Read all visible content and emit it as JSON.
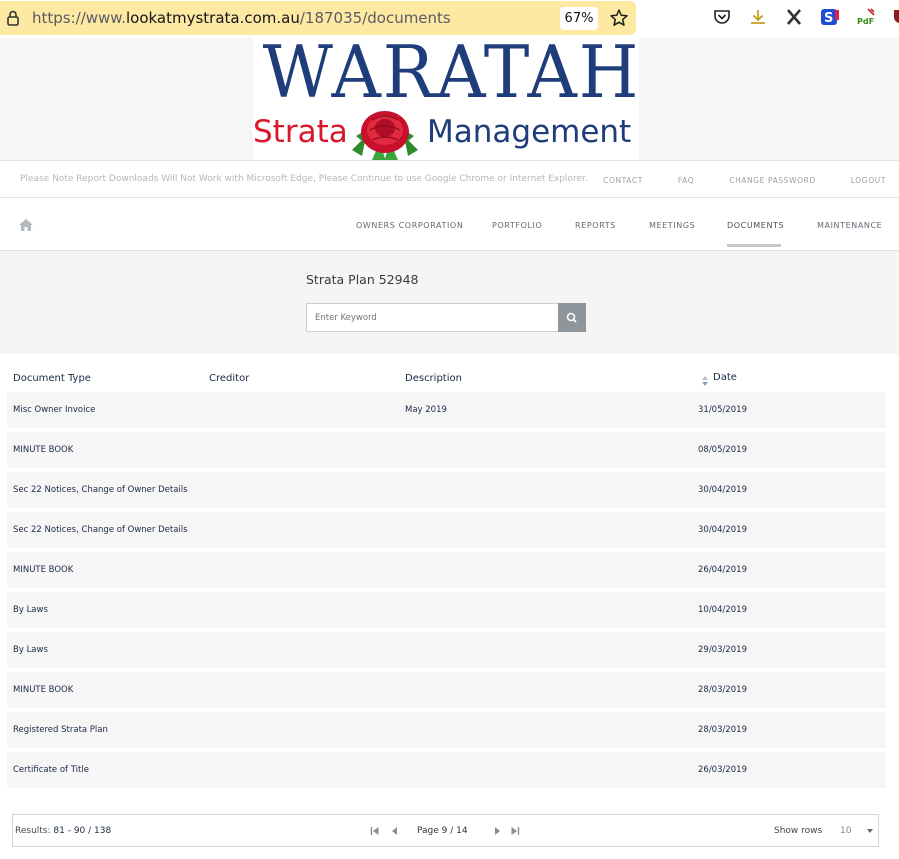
{
  "browser": {
    "url_prefix": "https://www.",
    "url_host": "lookatmystrata.com.au",
    "url_path": "/187035/documents",
    "zoom": "67%"
  },
  "logo": {
    "title": "WARATAH",
    "word_left": "Strata",
    "word_right": "Management"
  },
  "infobar": {
    "notice": "Please Note Report Downloads Will Not Work with Microsoft Edge, Please Continue to use Google Chrome or Internet Explorer.",
    "links": [
      "CONTACT",
      "FAQ",
      "CHANGE PASSWORD",
      "LOGOUT"
    ]
  },
  "nav": {
    "items": [
      "OWNERS CORPORATION",
      "PORTFOLIO",
      "REPORTS",
      "MEETINGS",
      "DOCUMENTS",
      "MAINTENANCE"
    ],
    "active": "DOCUMENTS"
  },
  "search": {
    "plan_title": "Strata Plan 52948",
    "placeholder": "Enter Keyword"
  },
  "table": {
    "headers": [
      "Document Type",
      "Creditor",
      "Description",
      "Date"
    ],
    "rows": [
      {
        "type": "Misc Owner Invoice",
        "creditor": "",
        "description": "May 2019",
        "date": "31/05/2019"
      },
      {
        "type": "MINUTE BOOK",
        "creditor": "",
        "description": "",
        "date": "08/05/2019"
      },
      {
        "type": "Sec 22 Notices, Change of Owner Details",
        "creditor": "",
        "description": "",
        "date": "30/04/2019"
      },
      {
        "type": "Sec 22 Notices, Change of Owner Details",
        "creditor": "",
        "description": "",
        "date": "30/04/2019"
      },
      {
        "type": "MINUTE BOOK",
        "creditor": "",
        "description": "",
        "date": "26/04/2019"
      },
      {
        "type": "By Laws",
        "creditor": "",
        "description": "",
        "date": "10/04/2019"
      },
      {
        "type": "By Laws",
        "creditor": "",
        "description": "",
        "date": "29/03/2019"
      },
      {
        "type": "MINUTE BOOK",
        "creditor": "",
        "description": "",
        "date": "28/03/2019"
      },
      {
        "type": "Registered Strata Plan",
        "creditor": "",
        "description": "",
        "date": "28/03/2019"
      },
      {
        "type": "Certificate of Title",
        "creditor": "",
        "description": "",
        "date": "26/03/2019"
      }
    ]
  },
  "pager": {
    "results_label": "Results:",
    "results_value": "81 - 90 / 138",
    "page_text": "Page 9 / 14",
    "show_rows_label": "Show rows",
    "rows_value": "10"
  },
  "colors": {
    "brand_blue": "#1f3d7a",
    "brand_red": "#d7182a",
    "url_bar": "#fde9a2"
  }
}
